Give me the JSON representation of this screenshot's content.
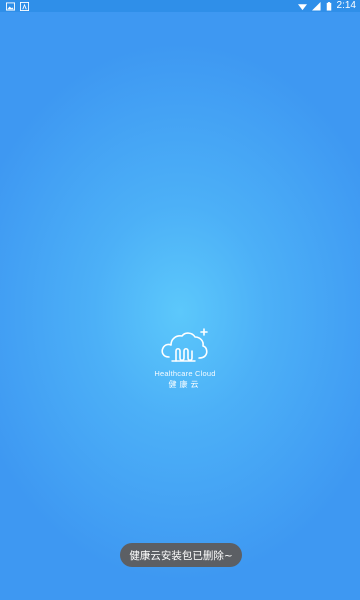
{
  "status_bar": {
    "left_icons": [
      "image-icon",
      "notification-a-icon"
    ],
    "right_icons": [
      "wifi-icon",
      "signal-icon",
      "battery-icon"
    ],
    "time": "2:14",
    "background_color": "#2f8fe9"
  },
  "splash": {
    "background_color": "#4cb0f7",
    "logo": {
      "icon": "cloud-logo-icon",
      "title_en": "Healthcare Cloud",
      "title_cn": "健康云"
    }
  },
  "toast": {
    "message": "健康云安装包已删除~",
    "background_color": "#5c5f64"
  }
}
